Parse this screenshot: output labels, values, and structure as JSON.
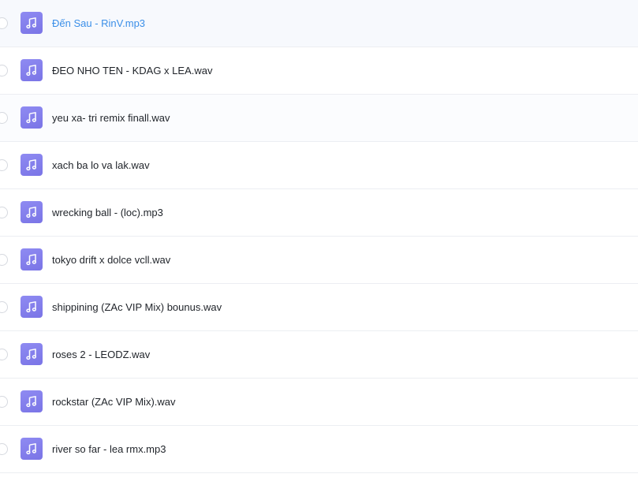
{
  "files": [
    {
      "name": "Đến Sau - RinV.mp3",
      "icon": "music-note-icon",
      "state": "hovered"
    },
    {
      "name": "ĐEO NHO TEN - KDAG x LEA.wav",
      "icon": "music-note-icon",
      "state": "normal"
    },
    {
      "name": "yeu xa- tri remix finall.wav",
      "icon": "music-note-icon",
      "state": "normal"
    },
    {
      "name": "xach ba lo va lak.wav",
      "icon": "music-note-icon",
      "state": "normal"
    },
    {
      "name": "wrecking ball - (loc).mp3",
      "icon": "music-note-icon",
      "state": "normal"
    },
    {
      "name": "tokyo drift x dolce vcll.wav",
      "icon": "music-note-icon",
      "state": "normal"
    },
    {
      "name": "shippining (ZAc VIP Mix) bounus.wav",
      "icon": "music-note-icon",
      "state": "normal"
    },
    {
      "name": "roses 2 - LEODZ.wav",
      "icon": "music-note-icon",
      "state": "normal"
    },
    {
      "name": "rockstar (ZAc VIP Mix).wav",
      "icon": "music-note-icon",
      "state": "normal"
    },
    {
      "name": "river so far - lea rmx.mp3",
      "icon": "music-note-icon",
      "state": "normal"
    }
  ],
  "colors": {
    "icon_bg": "#7f7aeb",
    "hover_text": "#3b8fe8",
    "text": "#1f2329",
    "divider": "#eceef2"
  }
}
